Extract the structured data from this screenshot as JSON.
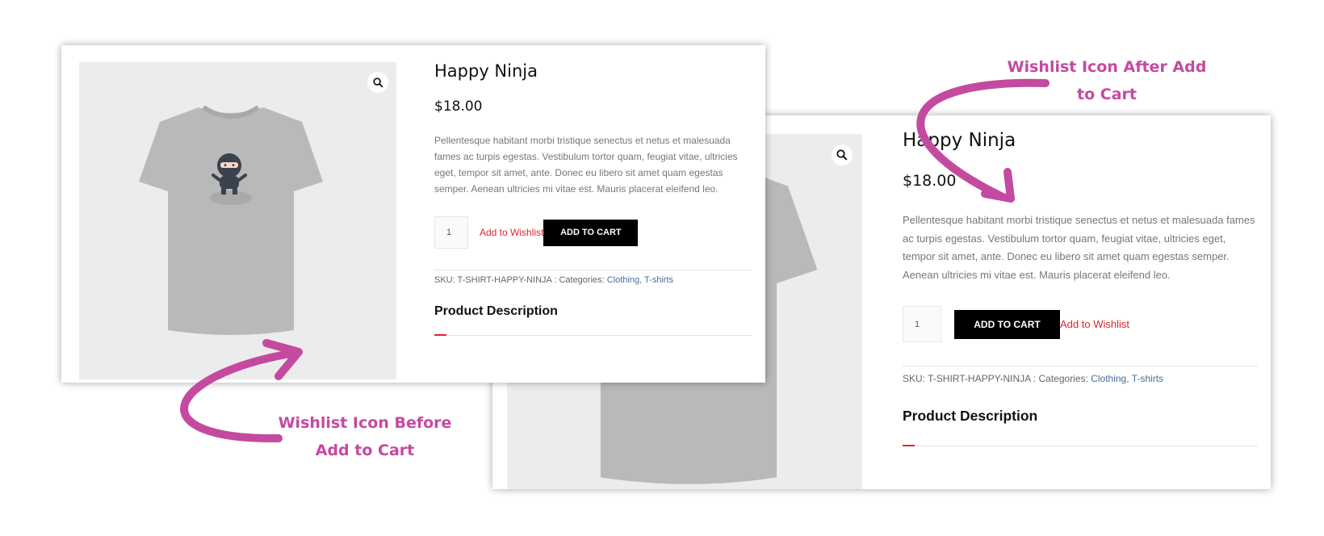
{
  "product": {
    "title": "Happy Ninja",
    "price": "$18.00",
    "description": "Pellentesque habitant morbi tristique senectus et netus et malesuada fames ac turpis egestas. Vestibulum tortor quam, feugiat vitae, ultricies eget, tempor sit amet, ante. Donec eu libero sit amet quam egestas semper. Aenean ultricies mi vitae est. Mauris placerat eleifend leo.",
    "quantity": "1",
    "add_to_cart": "ADD TO CART",
    "add_to_wishlist": "Add to Wishlist",
    "sku_text": "SKU: T-SHIRT-HAPPY-NINJA : Categories: ",
    "category_1": "Clothing",
    "category_separator": ", ",
    "category_2": "T-shirts",
    "section_title": "Product Description"
  },
  "callouts": {
    "before_line_1": "Wishlist Icon Before",
    "before_line_2": "Add to Cart",
    "after_line_1": "Wishlist Icon After Add",
    "after_line_2": "to Cart"
  },
  "colors": {
    "callout": "#c44aa0",
    "wishlist_link": "#e0252b",
    "button": "#000000"
  },
  "icons": [
    "search-icon",
    "tshirt-image",
    "arrow-icon"
  ]
}
